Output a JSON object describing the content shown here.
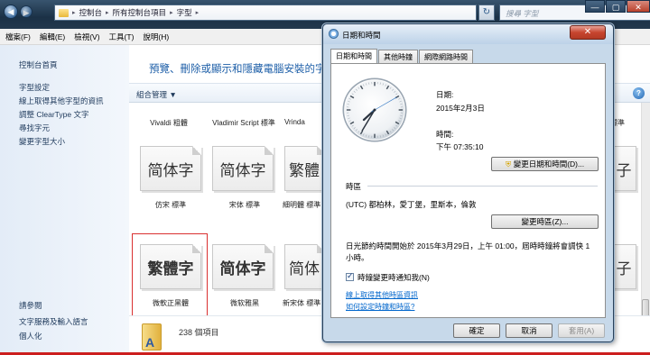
{
  "explorer": {
    "nav_back": "◀",
    "nav_fwd": "▶",
    "breadcrumb": [
      "控制台",
      "所有控制台項目",
      "字型"
    ],
    "search_placeholder": "搜尋 字型",
    "window_buttons": [
      "—",
      "▢",
      "✕"
    ],
    "menu": [
      "檔案(F)",
      "編輯(E)",
      "檢視(V)",
      "工具(T)",
      "說明(H)"
    ],
    "left_pane": {
      "home": "控制台首頁",
      "tasks": [
        "字型設定",
        "線上取得其他字型的資訊",
        "調整 ClearType 文字",
        "尋找字元",
        "變更字型大小"
      ],
      "see_also_header": "請參閱",
      "see_also": [
        "文字服務及輸入語言",
        "個人化"
      ]
    },
    "content_title": "預覽、刪除或顯示和隱藏電腦安裝的字型",
    "organize": "組合管理 ▼",
    "fonts_row1": [
      "Vivaldi 粗體",
      "Vladimir Script 標準",
      "Vrinda"
    ],
    "fonts_row1_right": "標準",
    "fonts_row2": [
      {
        "glyph": "简体字",
        "name": "仿宋 標準"
      },
      {
        "glyph": "简体字",
        "name": "宋体 標準"
      },
      {
        "glyph": "繁體",
        "name": "細明體 標準"
      }
    ],
    "fonts_row3": [
      {
        "glyph": "繁體字",
        "name": "微軟正黑體"
      },
      {
        "glyph": "简体字",
        "name": "微软雅黑"
      },
      {
        "glyph": "简体",
        "name": "新宋体 標準"
      }
    ],
    "right_glyph": "子",
    "status_count": "238 個項目"
  },
  "dialog": {
    "title": "日期和時間",
    "close": "✕",
    "tabs": [
      "日期和時間",
      "其他時鐘",
      "網際網路時間"
    ],
    "date_label": "日期:",
    "date_value": "2015年2月3日",
    "time_label": "時間:",
    "time_value": "下午 07:35:10",
    "clock_time": {
      "hour": 7,
      "minute": 35,
      "second": 10
    },
    "change_datetime_btn": "變更日期和時間(D)...",
    "timezone_header": "時區",
    "timezone_value": "(UTC) 都柏林，愛丁堡，里斯本，倫敦",
    "change_tz_btn": "變更時區(Z)...",
    "dst_text_1": "日光節約時間開始於 2015年3月29日，上午 01:00，屆時時鐘將會調快 1",
    "dst_text_2": "小時。",
    "notify_checkbox": "時鐘變更時通知我(N)",
    "notify_checked": true,
    "link_1": "線上取得其他時區資訊",
    "link_2": "如何設定時鐘和時區?",
    "ok": "確定",
    "cancel": "取消",
    "apply": "套用(A)"
  }
}
